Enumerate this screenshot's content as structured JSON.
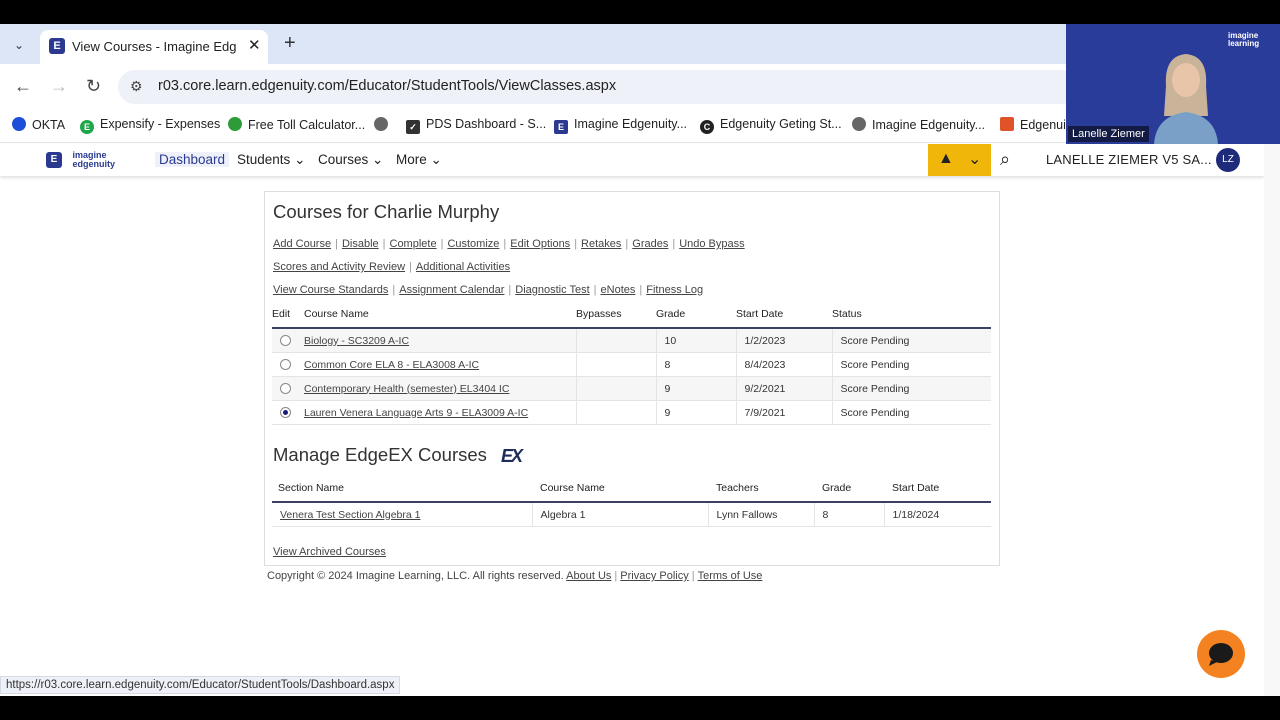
{
  "browser": {
    "tab_title": "View Courses - Imagine Edgenuity",
    "tab_close": "✕",
    "new_tab": "+",
    "url": "r03.core.learn.edgenuity.com/Educator/StudentTools/ViewClasses.aspx",
    "status_url": "https://r03.core.learn.edgenuity.com/Educator/StudentTools/Dashboard.aspx"
  },
  "bookmarks": [
    {
      "label": "OKTA",
      "color": "#1d4ed8"
    },
    {
      "label": "Expensify - Expenses",
      "color": "#1fa64a"
    },
    {
      "label": "Free Toll Calculator...",
      "color": "#2d9b3a"
    },
    {
      "label": "",
      "color": "#666666"
    },
    {
      "label": "PDS Dashboard - S...",
      "color": "#333333"
    },
    {
      "label": "Imagine Edgenuity...",
      "color": "#2b3a8f"
    },
    {
      "label": "Edgenuity Geting St...",
      "color": "#222222"
    },
    {
      "label": "Imagine Edgenuity...",
      "color": "#666666"
    },
    {
      "label": "Edgenuit",
      "color": "#e0522a"
    }
  ],
  "app": {
    "logo_line1": "imagine",
    "logo_line2": "edgenuity",
    "nav": [
      "Dashboard",
      "Students",
      "Courses",
      "More"
    ],
    "user_label": "LANELLE ZIEMER V5 SA...",
    "avatar": "LZ"
  },
  "courses": {
    "title": "Courses for Charlie Murphy",
    "links_row1": [
      "Add Course",
      "Disable",
      "Complete",
      "Customize",
      "Edit Options",
      "Retakes",
      "Grades",
      "Undo Bypass"
    ],
    "links_row2": [
      "Scores and Activity Review",
      "Additional Activities"
    ],
    "links_row3": [
      "View Course Standards",
      "Assignment Calendar",
      "Diagnostic Test",
      "eNotes",
      "Fitness Log"
    ],
    "headers": [
      "Edit",
      "Course Name",
      "Bypasses",
      "Grade",
      "Start Date",
      "Status"
    ],
    "rows": [
      {
        "name": "Biology - SC3209 A-IC",
        "bypasses": "",
        "grade": "10",
        "start": "1/2/2023",
        "status": "Score Pending",
        "selected": false
      },
      {
        "name": "Common Core ELA 8 - ELA3008 A-IC",
        "bypasses": "",
        "grade": "8",
        "start": "8/4/2023",
        "status": "Score Pending",
        "selected": false
      },
      {
        "name": "Contemporary Health (semester) EL3404 IC",
        "bypasses": "",
        "grade": "9",
        "start": "9/2/2021",
        "status": "Score Pending",
        "selected": false
      },
      {
        "name": "Lauren Venera Language Arts 9 - ELA3009 A-IC",
        "bypasses": "",
        "grade": "9",
        "start": "7/9/2021",
        "status": "Score Pending",
        "selected": true
      }
    ]
  },
  "edgeex": {
    "title": "Manage EdgeEX Courses",
    "logo": "EX",
    "headers": [
      "Section Name",
      "Course Name",
      "Teachers",
      "Grade",
      "Start Date"
    ],
    "rows": [
      {
        "section": "Venera Test Section Algebra 1",
        "course": "Algebra 1",
        "teachers": "Lynn Fallows",
        "grade": "8",
        "start": "1/18/2024"
      }
    ],
    "archived_link": "View Archived Courses"
  },
  "footer": {
    "copyright": "Copyright © 2024 Imagine Learning, LLC. All rights reserved.",
    "links": [
      "About Us",
      "Privacy Policy",
      "Terms of Use"
    ]
  },
  "webcam": {
    "name": "Lanelle Ziemer",
    "brand_line1": "imagine",
    "brand_line2": "learning"
  }
}
